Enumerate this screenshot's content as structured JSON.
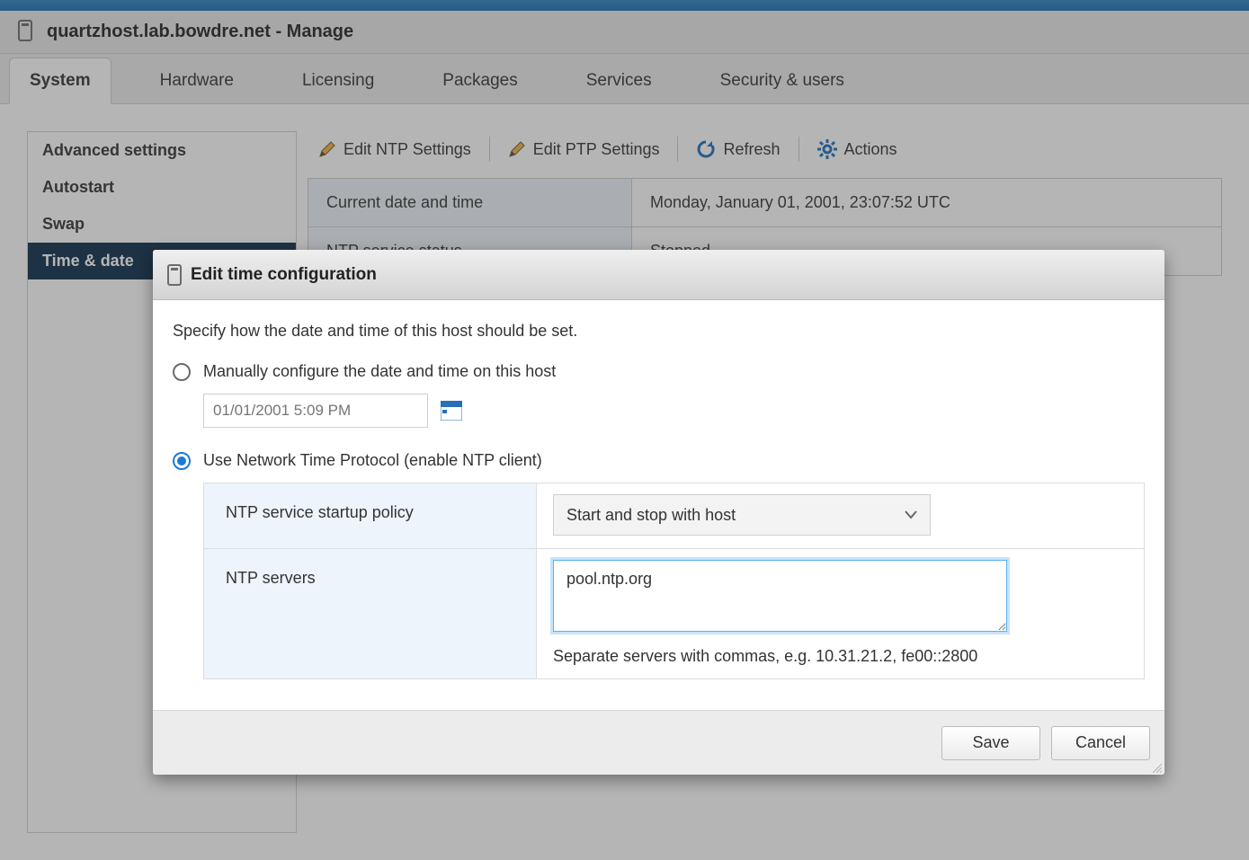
{
  "header": {
    "title": "quartzhost.lab.bowdre.net - Manage"
  },
  "tabs": {
    "items": [
      {
        "label": "System",
        "active": true
      },
      {
        "label": "Hardware"
      },
      {
        "label": "Licensing"
      },
      {
        "label": "Packages"
      },
      {
        "label": "Services"
      },
      {
        "label": "Security & users"
      }
    ]
  },
  "sidenav": {
    "items": [
      {
        "label": "Advanced settings"
      },
      {
        "label": "Autostart"
      },
      {
        "label": "Swap"
      },
      {
        "label": "Time & date",
        "active": true
      }
    ]
  },
  "toolbar": {
    "edit_ntp": "Edit NTP Settings",
    "edit_ptp": "Edit PTP Settings",
    "refresh": "Refresh",
    "actions": "Actions"
  },
  "info": {
    "current_label": "Current date and time",
    "current_value": "Monday, January 01, 2001, 23:07:52 UTC",
    "status_label": "NTP service status",
    "status_value": "Stopped"
  },
  "modal": {
    "title": "Edit time configuration",
    "description": "Specify how the date and time of this host should be set.",
    "opt_manual": "Manually configure the date and time on this host",
    "manual_value": "01/01/2001 5:09 PM",
    "opt_ntp": "Use Network Time Protocol (enable NTP client)",
    "policy_label": "NTP service startup policy",
    "policy_value": "Start and stop with host",
    "servers_label": "NTP servers",
    "servers_value": "pool.ntp.org",
    "servers_hint": "Separate servers with commas, e.g. 10.31.21.2, fe00::2800",
    "save": "Save",
    "cancel": "Cancel"
  }
}
